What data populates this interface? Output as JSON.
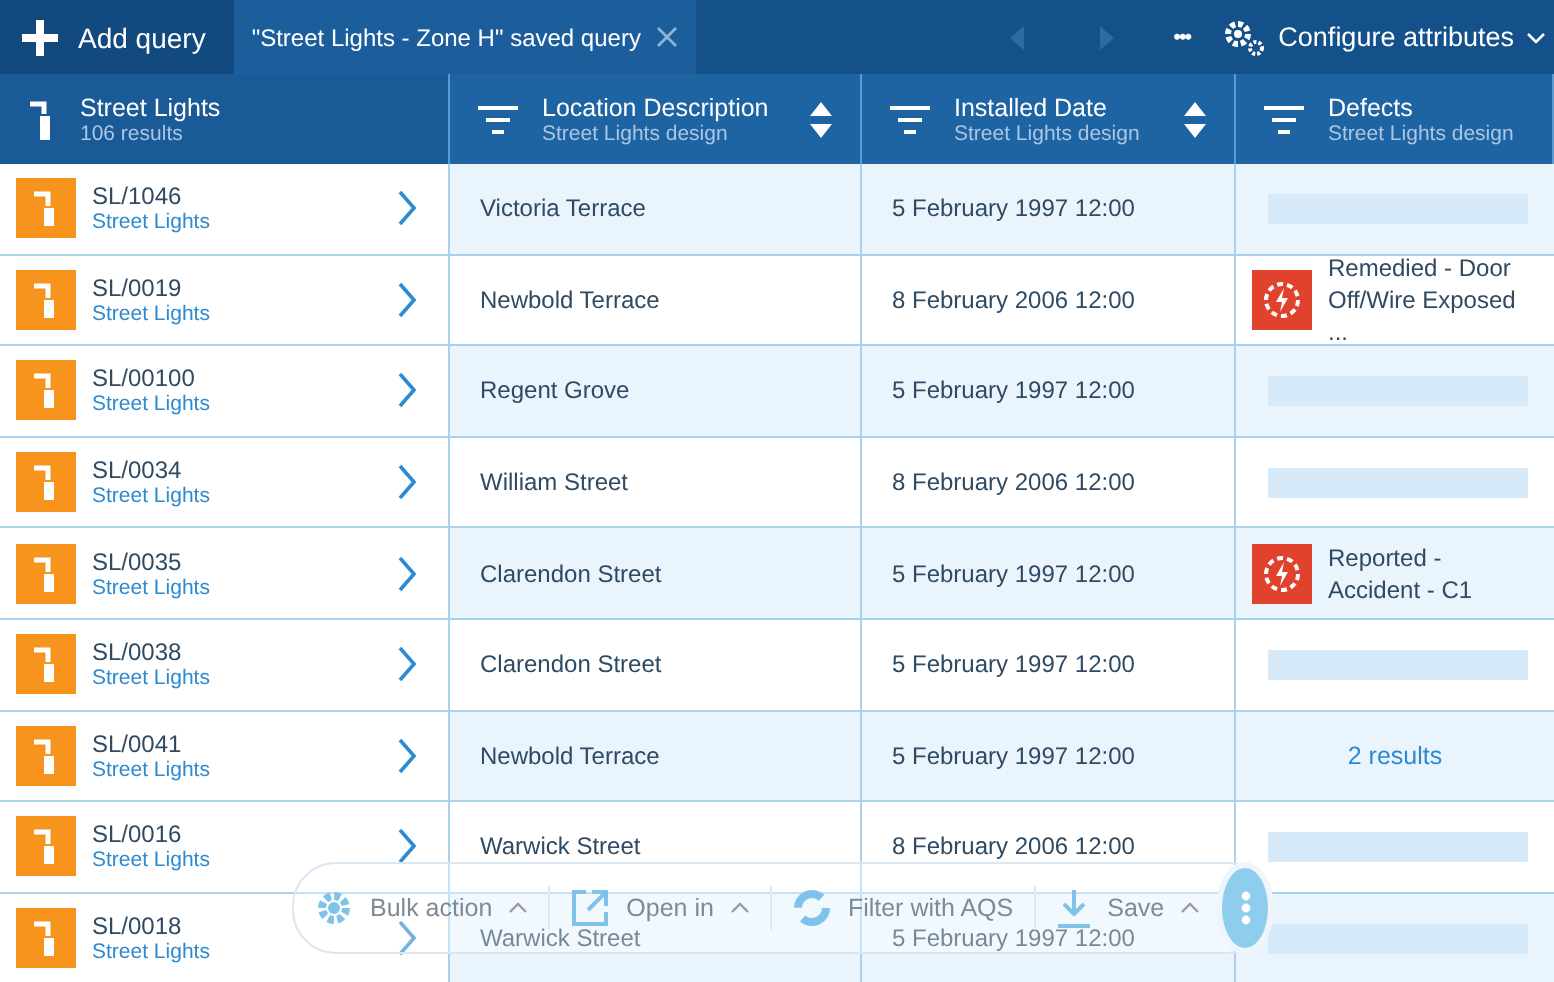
{
  "top_bar": {
    "add_button": "Add query",
    "tabs": [
      {
        "label": "\"Street Lights - Zone H\" saved query",
        "selected": true
      }
    ],
    "more": "•••",
    "configure": "Configure attributes"
  },
  "table": {
    "first_column": {
      "title": "Street Lights",
      "subtitle": "106 results"
    },
    "columns": [
      {
        "title": "Location Description",
        "subtitle": "Street Lights design",
        "sortable": true
      },
      {
        "title": "Installed Date",
        "subtitle": "Street Lights design",
        "sortable": true
      },
      {
        "title": "Defects",
        "subtitle": "Street Lights design",
        "sortable": false
      }
    ],
    "rows": [
      {
        "id": "SL/1046",
        "type": "Street Lights",
        "location": "Victoria Terrace",
        "date": "5 February 1997 12:00",
        "defect": {
          "kind": "empty"
        }
      },
      {
        "id": "SL/0019",
        "type": "Street Lights",
        "location": "Newbold Terrace",
        "date": "8 February 2006 12:00",
        "defect": {
          "kind": "defect",
          "text": "Remedied - Door Off/Wire Exposed ..."
        }
      },
      {
        "id": "SL/00100",
        "type": "Street Lights",
        "location": "Regent Grove",
        "date": "5 February 1997 12:00",
        "defect": {
          "kind": "empty"
        }
      },
      {
        "id": "SL/0034",
        "type": "Street Lights",
        "location": "William Street",
        "date": "8 February 2006 12:00",
        "defect": {
          "kind": "empty"
        }
      },
      {
        "id": "SL/0035",
        "type": "Street Lights",
        "location": "Clarendon Street",
        "date": "5 February 1997 12:00",
        "defect": {
          "kind": "defect",
          "text": "Reported - Accident - C1"
        }
      },
      {
        "id": "SL/0038",
        "type": "Street Lights",
        "location": "Clarendon Street",
        "date": "5 February 1997 12:00",
        "defect": {
          "kind": "empty"
        }
      },
      {
        "id": "SL/0041",
        "type": "Street Lights",
        "location": "Newbold Terrace",
        "date": "5 February 1997 12:00",
        "defect": {
          "kind": "count",
          "text": "2 results"
        }
      },
      {
        "id": "SL/0016",
        "type": "Street Lights",
        "location": "Warwick Street",
        "date": "8 February 2006 12:00",
        "defect": {
          "kind": "empty"
        }
      },
      {
        "id": "SL/0018",
        "type": "Street Lights",
        "location": "Warwick Street",
        "date": "5 February 1997 12:00",
        "defect": {
          "kind": "empty"
        }
      }
    ]
  },
  "action_bar": {
    "items": [
      {
        "kind": "gear",
        "label": "Bulk action",
        "caret": true
      },
      {
        "kind": "open",
        "label": "Open in",
        "caret": true
      },
      {
        "kind": "filter",
        "label": "Filter with AQS",
        "caret": false
      },
      {
        "kind": "save",
        "label": "Save",
        "caret": true
      }
    ]
  }
}
